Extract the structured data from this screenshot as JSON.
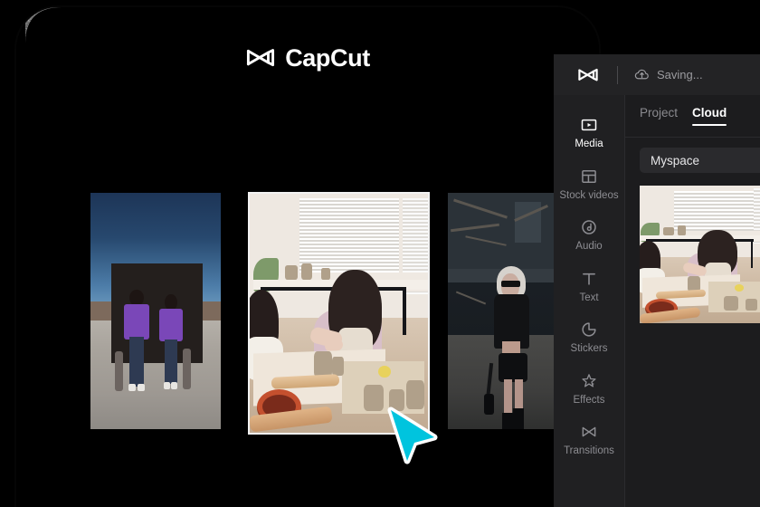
{
  "brand": {
    "name": "CapCut",
    "logo_icon": "capcut-bowtie-icon"
  },
  "hero": {
    "gallery": [
      {
        "id": "skaters",
        "alt": "Two skateboarders in purple t-shirts standing in front of a dark panel under a blue sky",
        "selected": false
      },
      {
        "id": "pottery",
        "alt": "Woman in a pink sweater shaping clay at a pottery studio table",
        "selected": true
      },
      {
        "id": "fashion",
        "alt": "Woman with platinum hair and sunglasses in a black outfit against a concrete wall",
        "selected": false
      }
    ]
  },
  "cursor": {
    "icon": "arrow-pointer-icon",
    "fill_color": "#00c4de",
    "outline_color": "#ffffff"
  },
  "editor": {
    "topbar": {
      "logo_icon": "capcut-bowtie-icon",
      "status_icon": "cloud-upload-icon",
      "status_text": "Saving..."
    },
    "rail": {
      "items": [
        {
          "label": "Media",
          "icon": "media-play-frame-icon",
          "active": true
        },
        {
          "label": "Stock videos",
          "icon": "layout-panels-icon",
          "active": false
        },
        {
          "label": "Audio",
          "icon": "music-note-circle-icon",
          "active": false
        },
        {
          "label": "Text",
          "icon": "text-t-icon",
          "active": false
        },
        {
          "label": "Stickers",
          "icon": "sticker-circle-icon",
          "active": false
        },
        {
          "label": "Effects",
          "icon": "effects-sparkle-icon",
          "active": false
        },
        {
          "label": "Transitions",
          "icon": "transition-bowtie-icon",
          "active": false
        }
      ]
    },
    "tabs": [
      {
        "label": "Project",
        "active": false
      },
      {
        "label": "Cloud",
        "active": true
      }
    ],
    "space": {
      "label": "Myspace"
    },
    "thumbnail": {
      "alt": "Woman in a pink sweater shaping clay at a pottery studio table"
    }
  },
  "colors": {
    "page_background": "#000000",
    "editor_background": "#1c1c1e",
    "editor_topbar": "#232325",
    "editor_rail": "#202022",
    "accent_cyan": "#00c4de",
    "active_text": "#ffffff",
    "muted_text": "#8a8a8f"
  }
}
